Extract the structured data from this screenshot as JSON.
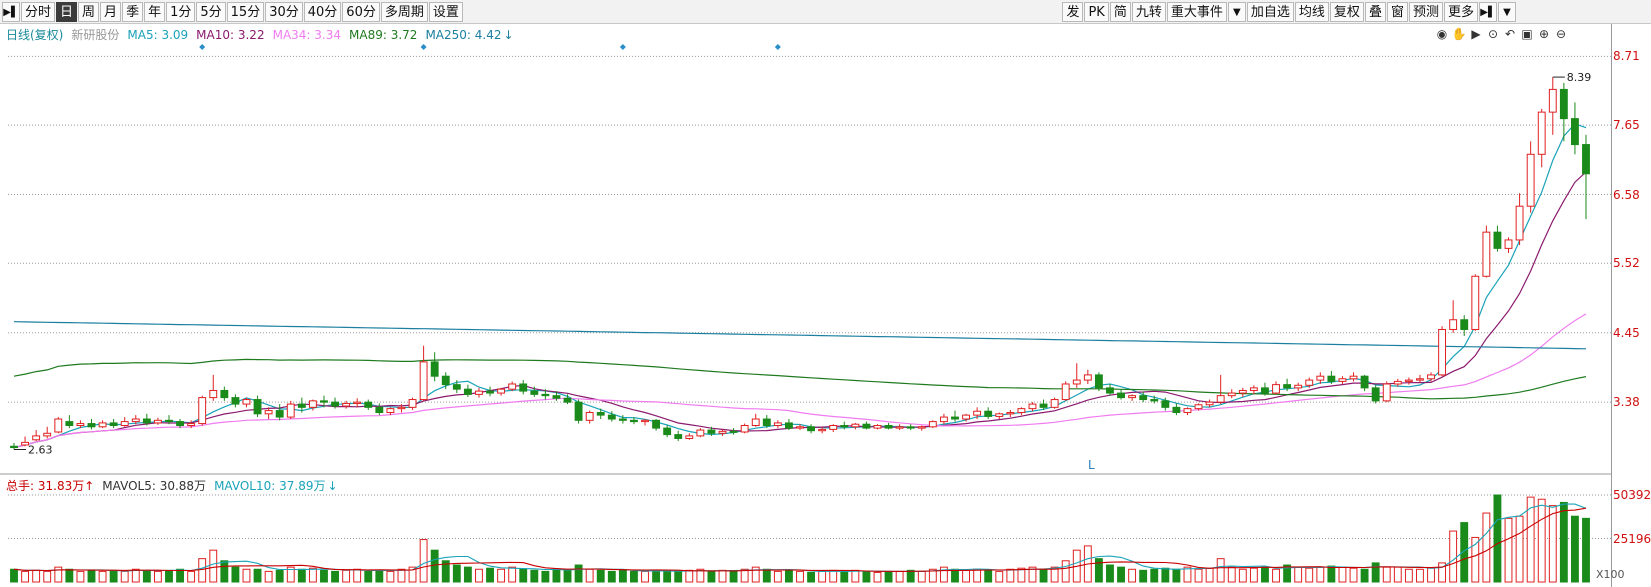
{
  "toolbar": {
    "left": [
      {
        "label": "▶▌",
        "name": "menu-toggle-button",
        "icon": true
      },
      {
        "label": "分时",
        "name": "tab-intraday"
      },
      {
        "label": "日",
        "name": "tab-daily",
        "selected": true
      },
      {
        "label": "周",
        "name": "tab-weekly"
      },
      {
        "label": "月",
        "name": "tab-monthly"
      },
      {
        "label": "季",
        "name": "tab-quarterly"
      },
      {
        "label": "年",
        "name": "tab-yearly"
      },
      {
        "label": "1分",
        "name": "tab-1min"
      },
      {
        "label": "5分",
        "name": "tab-5min"
      },
      {
        "label": "15分",
        "name": "tab-15min"
      },
      {
        "label": "30分",
        "name": "tab-30min"
      },
      {
        "label": "40分",
        "name": "tab-40min"
      },
      {
        "label": "60分",
        "name": "tab-60min"
      },
      {
        "label": "多周期",
        "name": "tab-multi-period"
      },
      {
        "label": "设置",
        "name": "settings-button"
      }
    ],
    "right": [
      {
        "label": "发",
        "name": "publish-button"
      },
      {
        "label": "PK",
        "name": "pk-button"
      },
      {
        "label": "简",
        "name": "simple-button"
      },
      {
        "label": "九转",
        "name": "nine-turn-button"
      },
      {
        "label": "重大事件",
        "name": "major-events-button"
      },
      {
        "label": "▼",
        "name": "events-dropdown-button",
        "icon": true
      },
      {
        "label": "加自选",
        "name": "add-watchlist-button"
      },
      {
        "label": "均线",
        "name": "ma-button"
      },
      {
        "label": "复权",
        "name": "adjust-button"
      },
      {
        "label": "叠",
        "name": "overlay-button"
      },
      {
        "label": "窗",
        "name": "window-button"
      },
      {
        "label": "预测",
        "name": "forecast-button"
      },
      {
        "label": "更多",
        "name": "more-button"
      },
      {
        "label": "▶▌",
        "name": "collapse-button",
        "icon": true
      },
      {
        "label": "▼",
        "name": "options-dropdown-button",
        "icon": true
      }
    ]
  },
  "indicator_line": {
    "period": "日线(复权)",
    "stock": "新研股份",
    "ma5": "MA5: 3.09",
    "ma10": "MA10: 3.22",
    "ma34": "MA34: 3.34",
    "ma89": "MA89: 3.72",
    "ma250": "MA250: 4.42",
    "arrow": "↓"
  },
  "volume_line": {
    "total": "总手: 31.83万↑",
    "mavol5": "MAVOL5: 30.88万",
    "mavol10": "MAVOL10: 37.89万",
    "arrow": "↓"
  },
  "price_axis": [
    "8.71",
    "7.65",
    "6.58",
    "5.52",
    "4.45",
    "3.38"
  ],
  "volume_axis": [
    "50392",
    "25196"
  ],
  "volume_unit": "X100",
  "max_label": "8.39",
  "min_label": "2.63",
  "marker": "L",
  "tool_icons": [
    {
      "name": "eye-icon",
      "glyph": "◉"
    },
    {
      "name": "hand-icon",
      "glyph": "✋"
    },
    {
      "name": "play-icon",
      "glyph": "▶"
    },
    {
      "name": "play-circle-icon",
      "glyph": "⊙"
    },
    {
      "name": "undo-icon",
      "glyph": "↶"
    },
    {
      "name": "lock-icon",
      "glyph": "▣"
    },
    {
      "name": "zoom-in-icon",
      "glyph": "⊕"
    },
    {
      "name": "zoom-out-icon",
      "glyph": "⊖"
    }
  ],
  "colors": {
    "up": "#e02020",
    "down": "#1a8a1a",
    "ma5": "#1aa3b8",
    "ma10": "#8b1a6e",
    "ma34": "#f07cf0",
    "ma89": "#1f7a1f",
    "ma250": "#1c7fa0",
    "axis": "#d01010",
    "vol_ma5": "#1aa3b8",
    "vol_ma10": "#c80000"
  },
  "chart_data": {
    "type": "candlestick",
    "title": "新研股份 日线(复权)",
    "ylim": [
      2.55,
      8.9
    ],
    "volume_max": 50392,
    "candles": [
      [
        2.7,
        2.75,
        2.68,
        2.65
      ],
      [
        2.72,
        2.85,
        2.76,
        2.7
      ],
      [
        2.8,
        2.95,
        2.86,
        2.78
      ],
      [
        2.86,
        3.0,
        2.9,
        2.82
      ],
      [
        2.92,
        3.15,
        3.12,
        2.9
      ],
      [
        3.08,
        3.18,
        3.02,
        2.98
      ],
      [
        3.02,
        3.1,
        3.05,
        2.98
      ],
      [
        3.05,
        3.12,
        3.0,
        2.96
      ],
      [
        3.0,
        3.1,
        3.06,
        2.98
      ],
      [
        3.06,
        3.12,
        3.02,
        2.98
      ],
      [
        3.02,
        3.15,
        3.08,
        3.0
      ],
      [
        3.08,
        3.18,
        3.12,
        3.04
      ],
      [
        3.12,
        3.2,
        3.06,
        3.02
      ],
      [
        3.06,
        3.14,
        3.1,
        3.03
      ],
      [
        3.1,
        3.18,
        3.08,
        3.04
      ],
      [
        3.08,
        3.12,
        3.02,
        2.98
      ],
      [
        3.02,
        3.1,
        3.05,
        2.98
      ],
      [
        3.05,
        3.48,
        3.45,
        3.02
      ],
      [
        3.45,
        3.8,
        3.56,
        3.4
      ],
      [
        3.56,
        3.62,
        3.45,
        3.4
      ],
      [
        3.45,
        3.5,
        3.35,
        3.3
      ],
      [
        3.35,
        3.45,
        3.42,
        3.3
      ],
      [
        3.42,
        3.48,
        3.2,
        3.15
      ],
      [
        3.2,
        3.3,
        3.25,
        3.12
      ],
      [
        3.25,
        3.35,
        3.15,
        3.1
      ],
      [
        3.15,
        3.4,
        3.35,
        3.12
      ],
      [
        3.35,
        3.45,
        3.3,
        3.22
      ],
      [
        3.3,
        3.42,
        3.4,
        3.25
      ],
      [
        3.4,
        3.48,
        3.38,
        3.3
      ],
      [
        3.38,
        3.45,
        3.32,
        3.28
      ],
      [
        3.32,
        3.4,
        3.36,
        3.28
      ],
      [
        3.36,
        3.44,
        3.38,
        3.3
      ],
      [
        3.38,
        3.42,
        3.3,
        3.26
      ],
      [
        3.3,
        3.36,
        3.22,
        3.18
      ],
      [
        3.22,
        3.3,
        3.28,
        3.18
      ],
      [
        3.28,
        3.35,
        3.3,
        3.22
      ],
      [
        3.3,
        3.45,
        3.42,
        3.26
      ],
      [
        3.42,
        4.25,
        4.0,
        3.4
      ],
      [
        4.0,
        4.15,
        3.78,
        3.7
      ],
      [
        3.78,
        3.84,
        3.65,
        3.58
      ],
      [
        3.65,
        3.72,
        3.58,
        3.52
      ],
      [
        3.58,
        3.65,
        3.5,
        3.46
      ],
      [
        3.5,
        3.6,
        3.55,
        3.45
      ],
      [
        3.55,
        3.62,
        3.52,
        3.47
      ],
      [
        3.52,
        3.6,
        3.58,
        3.48
      ],
      [
        3.58,
        3.7,
        3.66,
        3.55
      ],
      [
        3.66,
        3.72,
        3.55,
        3.5
      ],
      [
        3.55,
        3.62,
        3.5,
        3.46
      ],
      [
        3.5,
        3.58,
        3.48,
        3.42
      ],
      [
        3.48,
        3.55,
        3.44,
        3.4
      ],
      [
        3.44,
        3.5,
        3.38,
        3.35
      ],
      [
        3.38,
        3.42,
        3.1,
        3.05
      ],
      [
        3.1,
        3.25,
        3.22,
        3.05
      ],
      [
        3.22,
        3.28,
        3.18,
        3.12
      ],
      [
        3.18,
        3.24,
        3.12,
        3.08
      ],
      [
        3.12,
        3.18,
        3.1,
        3.05
      ],
      [
        3.1,
        3.15,
        3.08,
        3.04
      ],
      [
        3.08,
        3.12,
        3.1,
        3.02
      ],
      [
        3.1,
        3.12,
        2.98,
        2.94
      ],
      [
        2.98,
        3.02,
        2.88,
        2.84
      ],
      [
        2.88,
        2.94,
        2.82,
        2.78
      ],
      [
        2.82,
        2.9,
        2.86,
        2.8
      ],
      [
        2.86,
        2.98,
        2.95,
        2.84
      ],
      [
        2.95,
        3.0,
        2.9,
        2.86
      ],
      [
        2.9,
        2.96,
        2.93,
        2.86
      ],
      [
        2.93,
        2.98,
        2.92,
        2.88
      ],
      [
        2.92,
        3.05,
        3.02,
        2.9
      ],
      [
        3.02,
        3.2,
        3.12,
        3.0
      ],
      [
        3.12,
        3.18,
        3.02,
        2.98
      ],
      [
        3.02,
        3.1,
        3.06,
        2.98
      ],
      [
        3.06,
        3.12,
        2.98,
        2.95
      ],
      [
        2.98,
        3.04,
        3.0,
        2.95
      ],
      [
        3.0,
        3.04,
        2.94,
        2.9
      ],
      [
        2.94,
        3.0,
        2.96,
        2.9
      ],
      [
        2.96,
        3.04,
        3.02,
        2.92
      ],
      [
        3.02,
        3.08,
        3.0,
        2.96
      ],
      [
        3.0,
        3.06,
        3.04,
        2.96
      ],
      [
        3.04,
        3.08,
        2.98,
        2.96
      ],
      [
        2.98,
        3.04,
        3.02,
        2.96
      ],
      [
        3.02,
        3.06,
        2.98,
        2.96
      ],
      [
        2.98,
        3.04,
        3.0,
        2.95
      ],
      [
        3.0,
        3.04,
        2.98,
        2.95
      ],
      [
        2.98,
        3.02,
        3.0,
        2.94
      ],
      [
        3.0,
        3.1,
        3.08,
        2.98
      ],
      [
        3.08,
        3.2,
        3.15,
        3.04
      ],
      [
        3.15,
        3.25,
        3.12,
        3.08
      ],
      [
        3.12,
        3.2,
        3.18,
        3.08
      ],
      [
        3.18,
        3.3,
        3.24,
        3.12
      ],
      [
        3.24,
        3.3,
        3.16,
        3.12
      ],
      [
        3.16,
        3.22,
        3.2,
        3.12
      ],
      [
        3.2,
        3.26,
        3.22,
        3.15
      ],
      [
        3.22,
        3.3,
        3.28,
        3.18
      ],
      [
        3.28,
        3.38,
        3.35,
        3.24
      ],
      [
        3.35,
        3.42,
        3.3,
        3.26
      ],
      [
        3.3,
        3.45,
        3.42,
        3.28
      ],
      [
        3.42,
        3.7,
        3.66,
        3.4
      ],
      [
        3.66,
        3.98,
        3.72,
        3.6
      ],
      [
        3.72,
        3.88,
        3.8,
        3.66
      ],
      [
        3.8,
        3.84,
        3.6,
        3.55
      ],
      [
        3.6,
        3.66,
        3.52,
        3.48
      ],
      [
        3.52,
        3.58,
        3.45,
        3.42
      ],
      [
        3.45,
        3.5,
        3.48,
        3.4
      ],
      [
        3.48,
        3.54,
        3.42,
        3.38
      ],
      [
        3.42,
        3.48,
        3.4,
        3.36
      ],
      [
        3.4,
        3.45,
        3.3,
        3.25
      ],
      [
        3.3,
        3.36,
        3.22,
        3.18
      ],
      [
        3.22,
        3.3,
        3.28,
        3.18
      ],
      [
        3.28,
        3.36,
        3.34,
        3.25
      ],
      [
        3.34,
        3.42,
        3.38,
        3.3
      ],
      [
        3.38,
        3.8,
        3.48,
        3.35
      ],
      [
        3.48,
        3.58,
        3.52,
        3.44
      ],
      [
        3.52,
        3.6,
        3.56,
        3.46
      ],
      [
        3.56,
        3.64,
        3.6,
        3.5
      ],
      [
        3.6,
        3.68,
        3.52,
        3.48
      ],
      [
        3.52,
        3.7,
        3.65,
        3.5
      ],
      [
        3.65,
        3.74,
        3.6,
        3.55
      ],
      [
        3.6,
        3.68,
        3.64,
        3.55
      ],
      [
        3.64,
        3.76,
        3.72,
        3.6
      ],
      [
        3.72,
        3.84,
        3.78,
        3.66
      ],
      [
        3.78,
        3.86,
        3.7,
        3.66
      ],
      [
        3.7,
        3.78,
        3.74,
        3.66
      ],
      [
        3.74,
        3.84,
        3.78,
        3.7
      ],
      [
        3.78,
        3.8,
        3.6,
        3.55
      ],
      [
        3.6,
        3.64,
        3.4,
        3.36
      ],
      [
        3.4,
        3.7,
        3.66,
        3.38
      ],
      [
        3.66,
        3.74,
        3.7,
        3.62
      ],
      [
        3.7,
        3.76,
        3.72,
        3.65
      ],
      [
        3.72,
        3.8,
        3.74,
        3.68
      ],
      [
        3.74,
        3.84,
        3.8,
        3.7
      ],
      [
        3.8,
        4.55,
        4.5,
        3.78
      ],
      [
        4.5,
        4.95,
        4.65,
        4.45
      ],
      [
        4.65,
        4.72,
        4.5,
        4.4
      ],
      [
        4.5,
        5.35,
        5.32,
        4.48
      ],
      [
        5.32,
        6.1,
        6.0,
        5.3
      ],
      [
        6.0,
        6.1,
        5.75,
        5.7
      ],
      [
        5.75,
        5.92,
        5.88,
        5.68
      ],
      [
        5.88,
        6.6,
        6.4,
        5.8
      ],
      [
        6.4,
        7.4,
        7.2,
        6.3
      ],
      [
        7.2,
        7.9,
        7.85,
        7.0
      ],
      [
        7.85,
        8.39,
        8.2,
        7.5
      ],
      [
        8.2,
        8.3,
        7.75,
        7.4
      ],
      [
        7.75,
        8.0,
        7.35,
        7.2
      ],
      [
        7.35,
        7.5,
        6.9,
        6.2
      ]
    ],
    "volumes": [
      12,
      10,
      11,
      10,
      14,
      12,
      10,
      11,
      10,
      11,
      10,
      12,
      11,
      10,
      11,
      12,
      10,
      22,
      30,
      20,
      14,
      12,
      12,
      10,
      11,
      14,
      12,
      13,
      11,
      10,
      11,
      12,
      10,
      11,
      10,
      12,
      14,
      40,
      30,
      20,
      16,
      14,
      12,
      13,
      12,
      14,
      12,
      11,
      10,
      12,
      11,
      16,
      12,
      11,
      10,
      11,
      10,
      10,
      11,
      10,
      10,
      11,
      12,
      10,
      11,
      10,
      12,
      14,
      12,
      10,
      11,
      10,
      9,
      10,
      11,
      10,
      11,
      10,
      9,
      10,
      10,
      11,
      10,
      12,
      14,
      12,
      11,
      12,
      11,
      10,
      12,
      13,
      14,
      12,
      14,
      20,
      30,
      34,
      22,
      16,
      14,
      12,
      11,
      12,
      13,
      12,
      14,
      12,
      13,
      22,
      14,
      12,
      13,
      14,
      12,
      16,
      14,
      13,
      14,
      15,
      14,
      13,
      12,
      18,
      14,
      14,
      12,
      12,
      13,
      18,
      48,
      56,
      42,
      65,
      82,
      60,
      62,
      80,
      78,
      72,
      75,
      62,
      60
    ],
    "ma": {
      "MA5": {
        "last": 3.09
      },
      "MA10": {
        "last": 3.22
      },
      "MA34": {
        "last": 3.34
      },
      "MA89": {
        "last": 3.72
      },
      "MA250": {
        "last": 4.42
      }
    }
  }
}
